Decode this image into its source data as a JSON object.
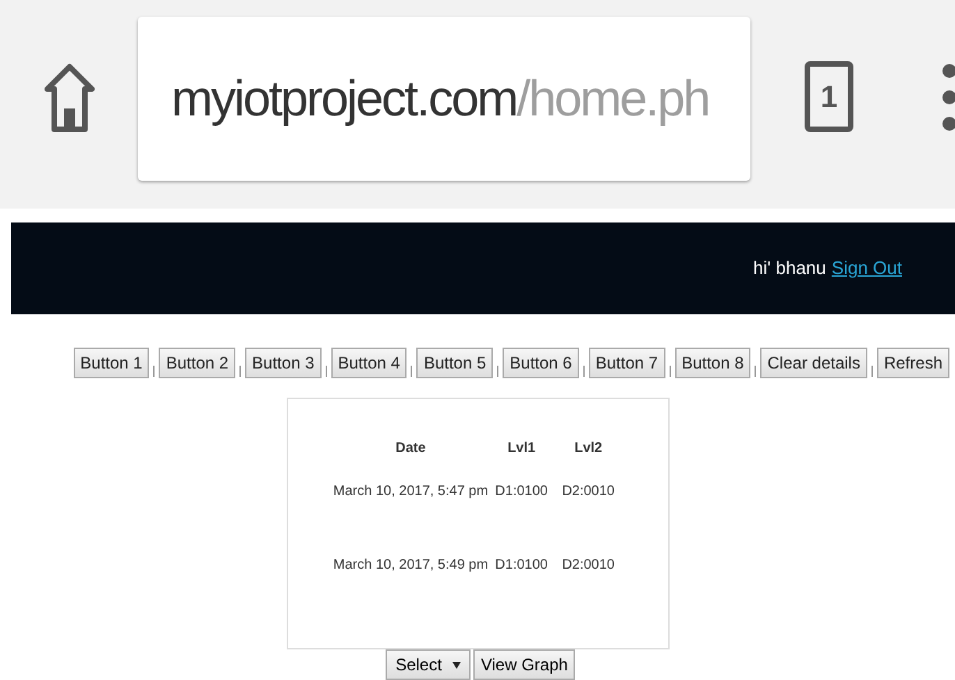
{
  "browser": {
    "url_host": "myiotproject.com",
    "url_path": "/home.ph",
    "tab_count": "1"
  },
  "header": {
    "greeting": "hi' bhanu",
    "link": "Sign Out"
  },
  "buttons": [
    "Button 1",
    "Button 2",
    "Button 3",
    "Button 4",
    "Button 5",
    "Button 6",
    "Button 7",
    "Button 8",
    "Clear details",
    "Refresh"
  ],
  "table": {
    "columns": [
      "Date",
      "Lvl1",
      "Lvl2"
    ],
    "rows": [
      [
        "March 10, 2017, 5:47 pm",
        "D1:0100",
        "D2:0010"
      ],
      [
        "March 10, 2017, 5:49 pm",
        "D1:0100",
        "D2:0010"
      ]
    ]
  },
  "select": {
    "value": "Select"
  },
  "graph_button": "View Graph"
}
